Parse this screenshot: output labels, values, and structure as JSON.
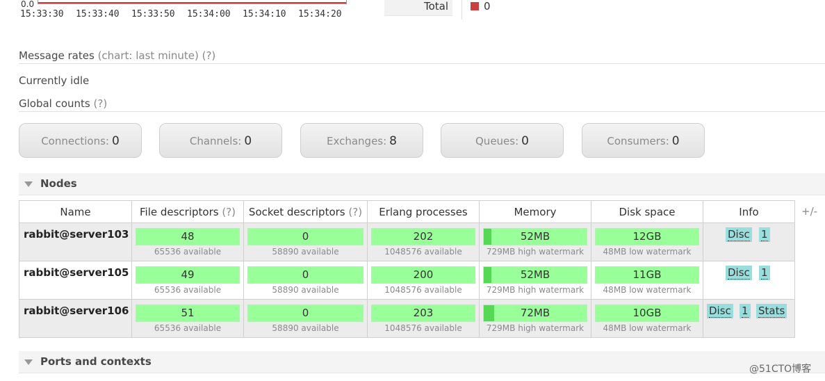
{
  "chart": {
    "y_zero": "0.0",
    "x_ticks": [
      "15:33:30",
      "15:33:40",
      "15:33:50",
      "15:34:00",
      "15:34:10",
      "15:34:20"
    ],
    "legend_label": "Total",
    "legend_value": "0",
    "line_color": "#c94040"
  },
  "message_rates": {
    "title": "Message rates",
    "subtitle": "(chart: last minute)",
    "help": "(?)"
  },
  "idle_text": "Currently idle",
  "global_counts": {
    "title": "Global counts",
    "help": "(?)",
    "items": [
      {
        "label": "Connections:",
        "value": "0"
      },
      {
        "label": "Channels:",
        "value": "0"
      },
      {
        "label": "Exchanges:",
        "value": "8"
      },
      {
        "label": "Queues:",
        "value": "0"
      },
      {
        "label": "Consumers:",
        "value": "0"
      }
    ]
  },
  "nodes": {
    "title": "Nodes",
    "plus_minus": "+/-",
    "columns": {
      "name": "Name",
      "file": "File descriptors",
      "socket": "Socket descriptors",
      "help": "(?)",
      "erlang": "Erlang processes",
      "memory": "Memory",
      "disk": "Disk space",
      "info": "Info"
    },
    "rows": [
      {
        "name": "rabbit@server103",
        "file": "48",
        "file_sub": "65536 available",
        "socket": "0",
        "socket_sub": "58890 available",
        "erlang": "202",
        "erlang_sub": "1048576 available",
        "memory": "52MB",
        "memory_sub": "729MB high watermark",
        "memory_fill": 0.071,
        "disk": "12GB",
        "disk_sub": "48MB low watermark",
        "info": [
          "Disc",
          "1"
        ]
      },
      {
        "name": "rabbit@server105",
        "file": "49",
        "file_sub": "65536 available",
        "socket": "0",
        "socket_sub": "58890 available",
        "erlang": "200",
        "erlang_sub": "1048576 available",
        "memory": "52MB",
        "memory_sub": "729MB high watermark",
        "memory_fill": 0.071,
        "disk": "11GB",
        "disk_sub": "48MB low watermark",
        "info": [
          "Disc",
          "1"
        ]
      },
      {
        "name": "rabbit@server106",
        "file": "51",
        "file_sub": "65536 available",
        "socket": "0",
        "socket_sub": "58890 available",
        "erlang": "203",
        "erlang_sub": "1048576 available",
        "memory": "72MB",
        "memory_sub": "729MB high watermark",
        "memory_fill": 0.099,
        "disk": "10GB",
        "disk_sub": "48MB low watermark",
        "info": [
          "Disc",
          "1",
          "Stats"
        ]
      }
    ]
  },
  "ports": {
    "title": "Ports and contexts"
  },
  "watermark": "@51CTO博客"
}
